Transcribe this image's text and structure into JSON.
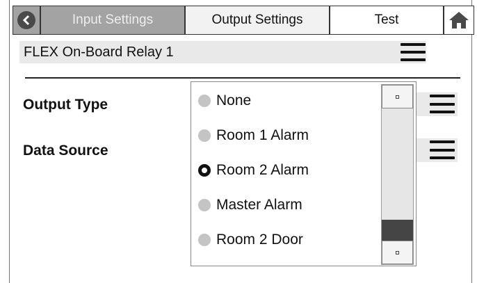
{
  "tabs": {
    "back_icon": "chevron-left-icon",
    "input_settings": "Input Settings",
    "output_settings": "Output Settings",
    "test": "Test",
    "home_icon": "home-icon",
    "active": "Output Settings"
  },
  "relay": {
    "name": "FLEX On-Board Relay 1",
    "menu_icon": "menu-icon"
  },
  "fields": {
    "output_type_label": "Output Type",
    "data_source_label": "Data Source"
  },
  "dropdown": {
    "options": [
      {
        "label": "None",
        "selected": false
      },
      {
        "label": "Room 1 Alarm",
        "selected": false
      },
      {
        "label": "Room 2 Alarm",
        "selected": true
      },
      {
        "label": "Master Alarm",
        "selected": false
      },
      {
        "label": "Room 2 Door",
        "selected": false
      }
    ],
    "selected": "Room 2 Alarm"
  },
  "colors": {
    "inactive_tab": "#a3a3a3",
    "active_tab": "#f2f2f2",
    "row_background": "#e9e9e9",
    "scroll_thumb": "#454545"
  }
}
